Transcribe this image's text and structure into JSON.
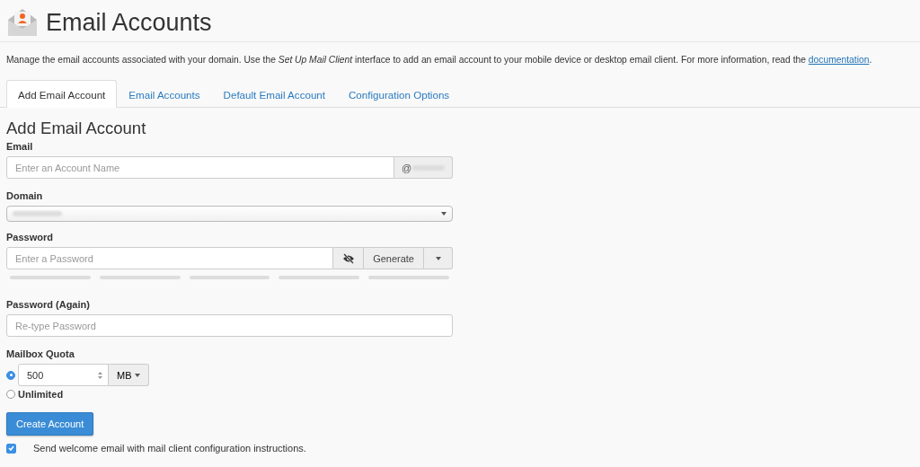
{
  "header": {
    "title": "Email Accounts"
  },
  "description": {
    "text": "Manage the email accounts associated with your domain. Use the *Set Up Mail Client* interface to add an email account to your mobile device or desktop email client. For more information, read the ",
    "link": "documentation",
    "after": "."
  },
  "tabs": [
    {
      "label": "Add Email Account",
      "selected": true
    },
    {
      "label": "Email Accounts",
      "selected": false
    },
    {
      "label": "Default Email Account",
      "selected": false
    },
    {
      "label": "Configuration Options",
      "selected": false
    }
  ],
  "form": {
    "heading": "Add Email Account",
    "email": {
      "label": "Email",
      "placeholder": "Enter an Account Name",
      "addon": "@"
    },
    "domain": {
      "label": "Domain"
    },
    "password": {
      "label": "Password",
      "placeholder": "Enter a Password",
      "generate": "Generate",
      "strength": {
        "level": 0
      }
    },
    "password_again": {
      "label": "Password (Again)",
      "placeholder": "Re-type Password"
    },
    "quota": {
      "label": "Mailbox Quota",
      "options": [
        {
          "kind": "number",
          "value": "500",
          "unit": "MB",
          "selected": true
        },
        {
          "kind": "unlimited",
          "label": "Unlimited",
          "selected": false
        }
      ]
    },
    "submit": "Create Account",
    "welcome": {
      "label": "Send welcome email with mail client configuration instructions.",
      "checked": true
    }
  }
}
